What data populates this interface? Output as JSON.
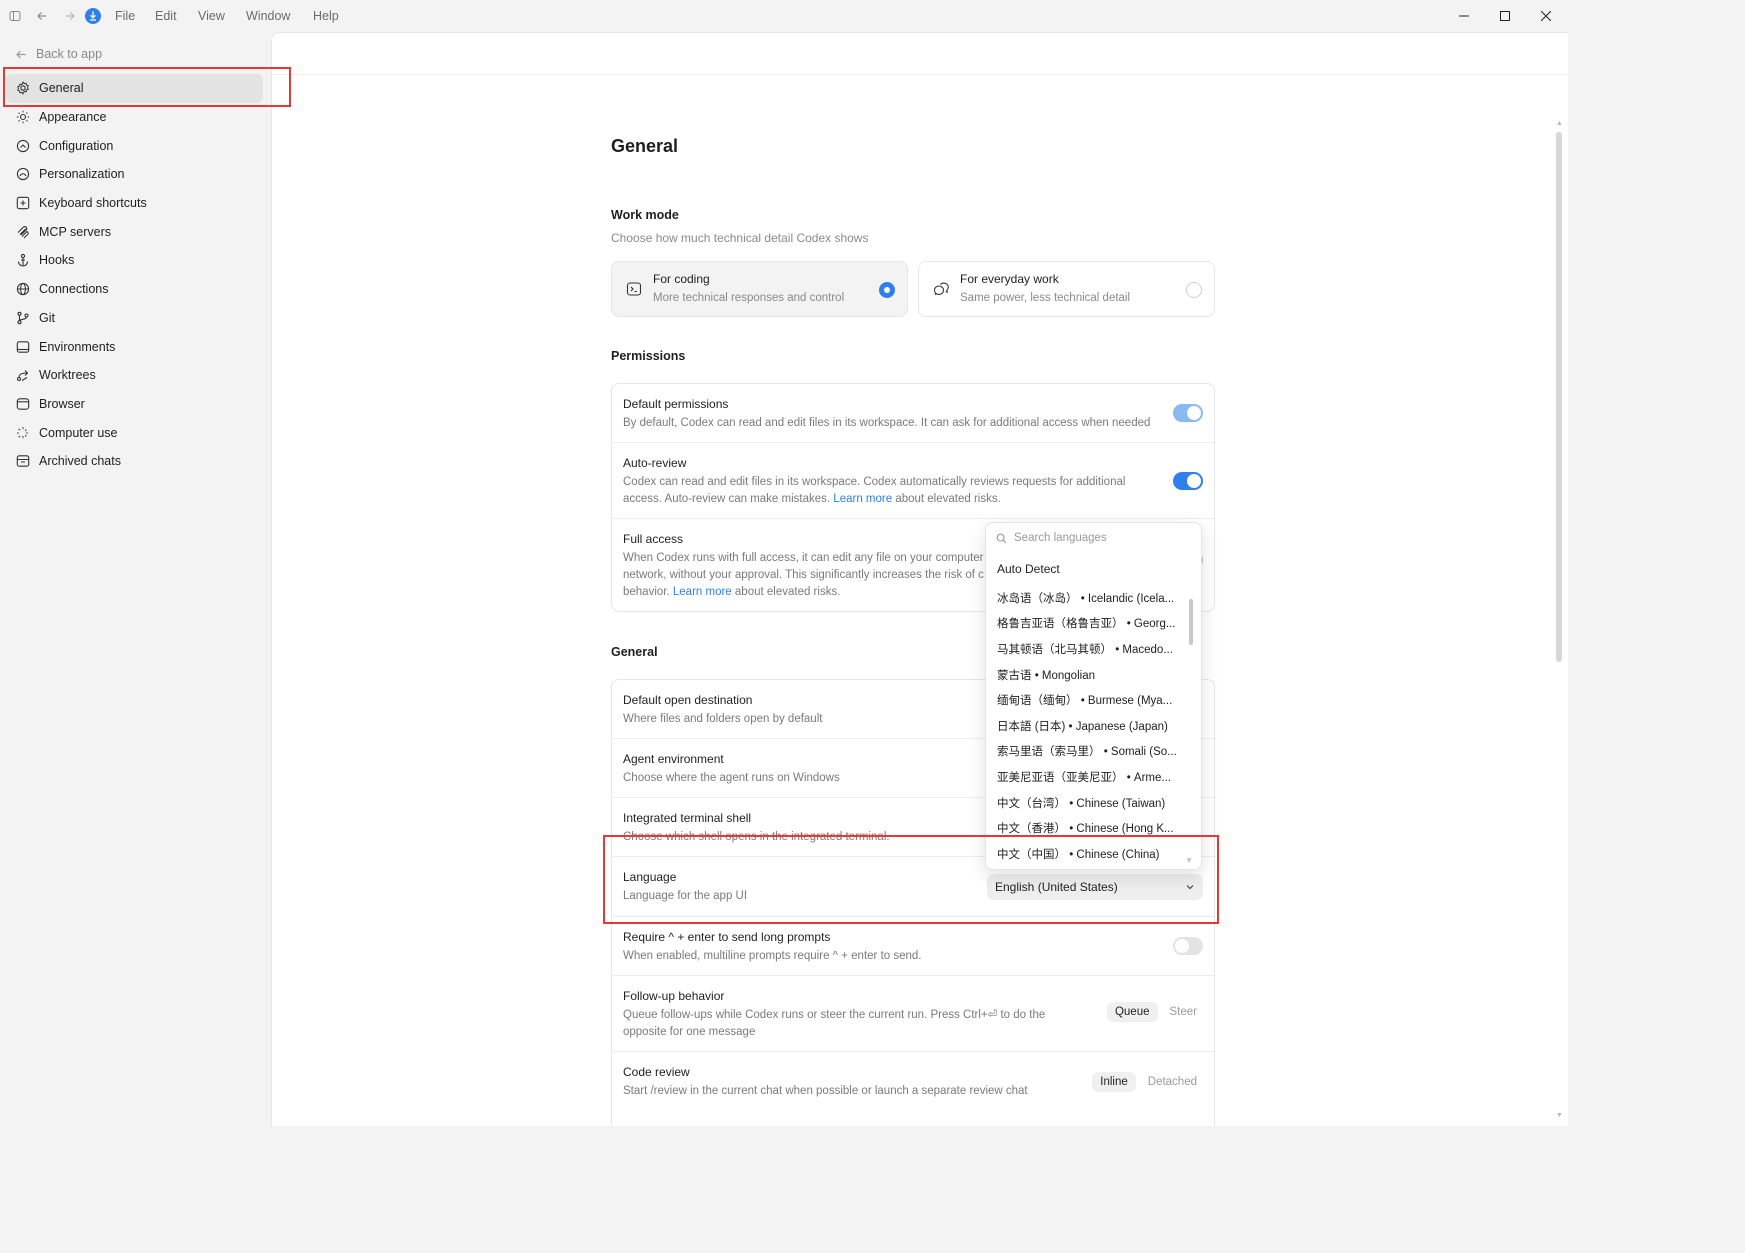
{
  "titlebar": {
    "menus": [
      "File",
      "Edit",
      "View",
      "Window",
      "Help"
    ]
  },
  "sidebar": {
    "back_label": "Back to app",
    "items": [
      {
        "label": "General",
        "icon": "gear-icon"
      },
      {
        "label": "Appearance",
        "icon": "sun-icon"
      },
      {
        "label": "Configuration",
        "icon": "config-icon"
      },
      {
        "label": "Personalization",
        "icon": "personalization-icon"
      },
      {
        "label": "Keyboard shortcuts",
        "icon": "keyboard-icon"
      },
      {
        "label": "MCP servers",
        "icon": "mcp-icon"
      },
      {
        "label": "Hooks",
        "icon": "hook-icon"
      },
      {
        "label": "Connections",
        "icon": "globe-icon"
      },
      {
        "label": "Git",
        "icon": "branch-icon"
      },
      {
        "label": "Environments",
        "icon": "monitor-icon"
      },
      {
        "label": "Worktrees",
        "icon": "worktree-icon"
      },
      {
        "label": "Browser",
        "icon": "browser-icon"
      },
      {
        "label": "Computer use",
        "icon": "sparkle-icon"
      },
      {
        "label": "Archived chats",
        "icon": "archive-icon"
      }
    ]
  },
  "main": {
    "title": "General",
    "work_mode": {
      "title": "Work mode",
      "subtitle": "Choose how much technical detail Codex shows",
      "options": [
        {
          "title": "For coding",
          "desc": "More technical responses and control",
          "selected": true
        },
        {
          "title": "For everyday work",
          "desc": "Same power, less technical detail",
          "selected": false
        }
      ]
    },
    "permissions": {
      "title": "Permissions",
      "default": {
        "title": "Default permissions",
        "desc": "By default, Codex can read and edit files in its workspace. It can ask for additional access when needed"
      },
      "auto_review": {
        "title": "Auto-review",
        "desc_a": "Codex can read and edit files in its workspace. Codex automatically reviews requests for additional access. Auto-review can make mistakes.",
        "link": "Learn more",
        "desc_b": "about elevated risks."
      },
      "full_access": {
        "title": "Full access",
        "desc_a": "When Codex runs with full access, it can edit any file on your computer",
        "desc_a2": "network, without your approval. This significantly increases the risk of c",
        "desc_a3": "behavior.",
        "link": "Learn more",
        "desc_b": "about elevated risks."
      }
    },
    "general": {
      "title": "General",
      "open_dest": {
        "title": "Default open destination",
        "desc": "Where files and folders open by default"
      },
      "agent_env": {
        "title": "Agent environment",
        "desc": "Choose where the agent runs on Windows"
      },
      "terminal": {
        "title": "Integrated terminal shell",
        "desc": "Choose which shell opens in the integrated terminal."
      },
      "language": {
        "title": "Language",
        "desc": "Language for the app UI",
        "value": "English (United States)"
      },
      "require": {
        "title": "Require ^ + enter to send long prompts",
        "desc": "When enabled, multiline prompts require ^ + enter to send."
      },
      "followup": {
        "title": "Follow-up behavior",
        "desc": "Queue follow-ups while Codex runs or steer the current run. Press Ctrl+⏎ to do the opposite for one message",
        "opt_on": "Queue",
        "opt_off": "Steer"
      },
      "code_review": {
        "title": "Code review",
        "desc": "Start /review in the current chat when possible or launch a separate review chat",
        "opt_on": "Inline",
        "opt_off": "Detached"
      }
    }
  },
  "language_dropdown": {
    "search_placeholder": "Search languages",
    "auto": "Auto Detect",
    "items": [
      "冰岛语（冰岛） • Icelandic (Icela...",
      "格鲁吉亚语（格鲁吉亚） • Georg...",
      "马其顿语（北马其顿） • Macedo...",
      "蒙古语 • Mongolian",
      "缅甸语（缅甸） • Burmese (Mya...",
      "日本語 (日本) • Japanese (Japan)",
      "索马里语（索马里） • Somali (So...",
      "亚美尼亚语（亚美尼亚） • Arme...",
      "中文（台湾） • Chinese (Taiwan)",
      "中文（香港） • Chinese (Hong K...",
      "中文（中国） • Chinese (China)"
    ]
  },
  "colors": {
    "accent": "#2f80ed",
    "highlight": "#e53935"
  }
}
